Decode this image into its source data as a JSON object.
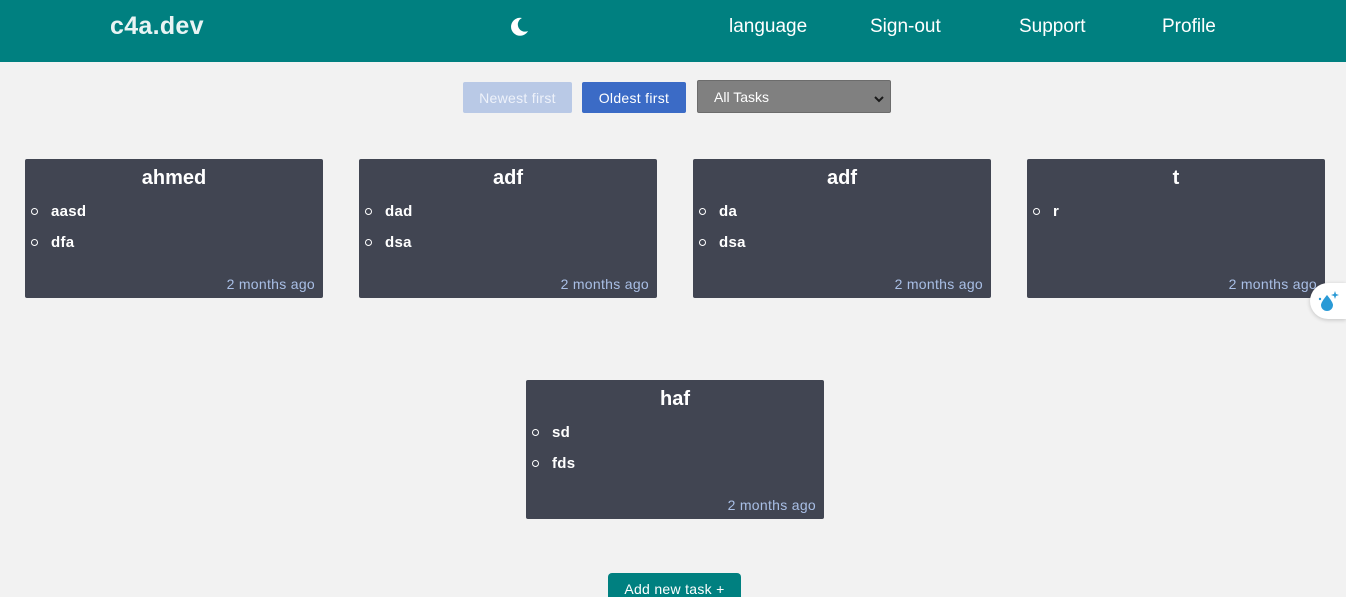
{
  "header": {
    "brand": "c4a.dev",
    "theme_icon": "moon-icon",
    "links": [
      "language",
      "Sign-out",
      "Support",
      "Profile"
    ]
  },
  "controls": {
    "newest_label": "Newest first",
    "oldest_label": "Oldest first",
    "filter_selected": "All Tasks"
  },
  "cards": [
    {
      "title": "ahmed",
      "items": [
        "aasd",
        "dfa"
      ],
      "time": "2 months ago"
    },
    {
      "title": "adf",
      "items": [
        "dad",
        "dsa"
      ],
      "time": "2 months ago"
    },
    {
      "title": "adf",
      "items": [
        "da",
        "dsa"
      ],
      "time": "2 months ago"
    },
    {
      "title": "t",
      "items": [
        "r"
      ],
      "time": "2 months ago"
    },
    {
      "title": "haf",
      "items": [
        "sd",
        "fds"
      ],
      "time": "2 months ago"
    }
  ],
  "add_button": "Add new task +",
  "colors": {
    "navbar": "#008080",
    "card_bg": "#414552",
    "primary_button": "#3b6bc6",
    "timestamp": "#a9bfe6"
  }
}
